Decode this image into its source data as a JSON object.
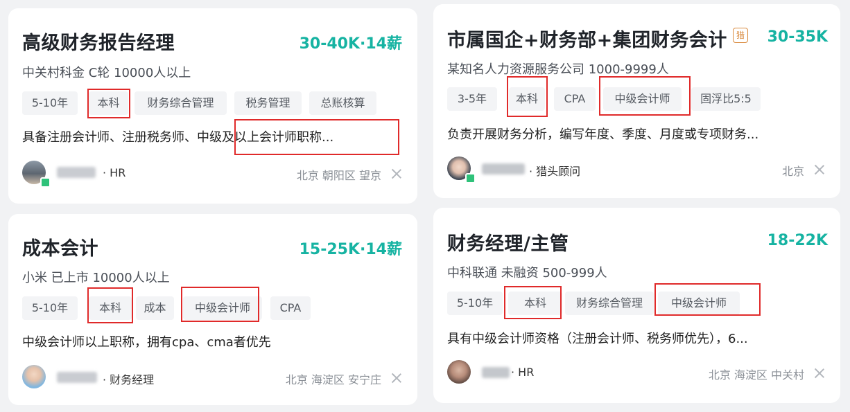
{
  "jobs": [
    {
      "title": "高级财务报告经理",
      "salary": "30-40K·14薪",
      "company": "中关村科金 C轮 10000人以上",
      "tags": [
        "5-10年",
        "本科",
        "财务综合管理",
        "税务管理",
        "总账核算"
      ],
      "description": "具备注册会计师、注册税务师、中级及以上会计师职称...",
      "recruiter_role": "· HR",
      "location": "北京 朝阳区 望京"
    },
    {
      "title": "成本会计",
      "salary": "15-25K·14薪",
      "company": "小米 已上市 10000人以上",
      "tags": [
        "5-10年",
        "本科",
        "成本",
        "中级会计师",
        "CPA"
      ],
      "description": "中级会计师以上职称，拥有cpa、cma者优先",
      "recruiter_role": "· 财务经理",
      "location": "北京 海淀区 安宁庄"
    },
    {
      "title": "市属国企+财务部+集团财务会计",
      "badge": "猎",
      "salary": "30-35K",
      "company": "某知名人力资源服务公司 1000-9999人",
      "tags": [
        "3-5年",
        "本科",
        "CPA",
        "中级会计师",
        "固浮比5:5"
      ],
      "description": "负责开展财务分析，编写年度、季度、月度或专项财务...",
      "recruiter_role": "· 猎头顾问",
      "location": "北京"
    },
    {
      "title": "财务经理/主管",
      "salary": "18-22K",
      "company": "中科联通 未融资 500-999人",
      "tags": [
        "5-10年",
        "本科",
        "财务综合管理",
        "中级会计师"
      ],
      "description": "具有中级会计师资格（注册会计师、税务师优先），6...",
      "recruiter_role": "· HR",
      "location": "北京 海淀区 中关村"
    }
  ],
  "colors": {
    "background": "#f1f2f4",
    "salary": "#16b3a2",
    "highlight_box": "#e02a2a",
    "tag_bg": "#f3f4f6",
    "hunter_badge": "#d98a3d"
  }
}
